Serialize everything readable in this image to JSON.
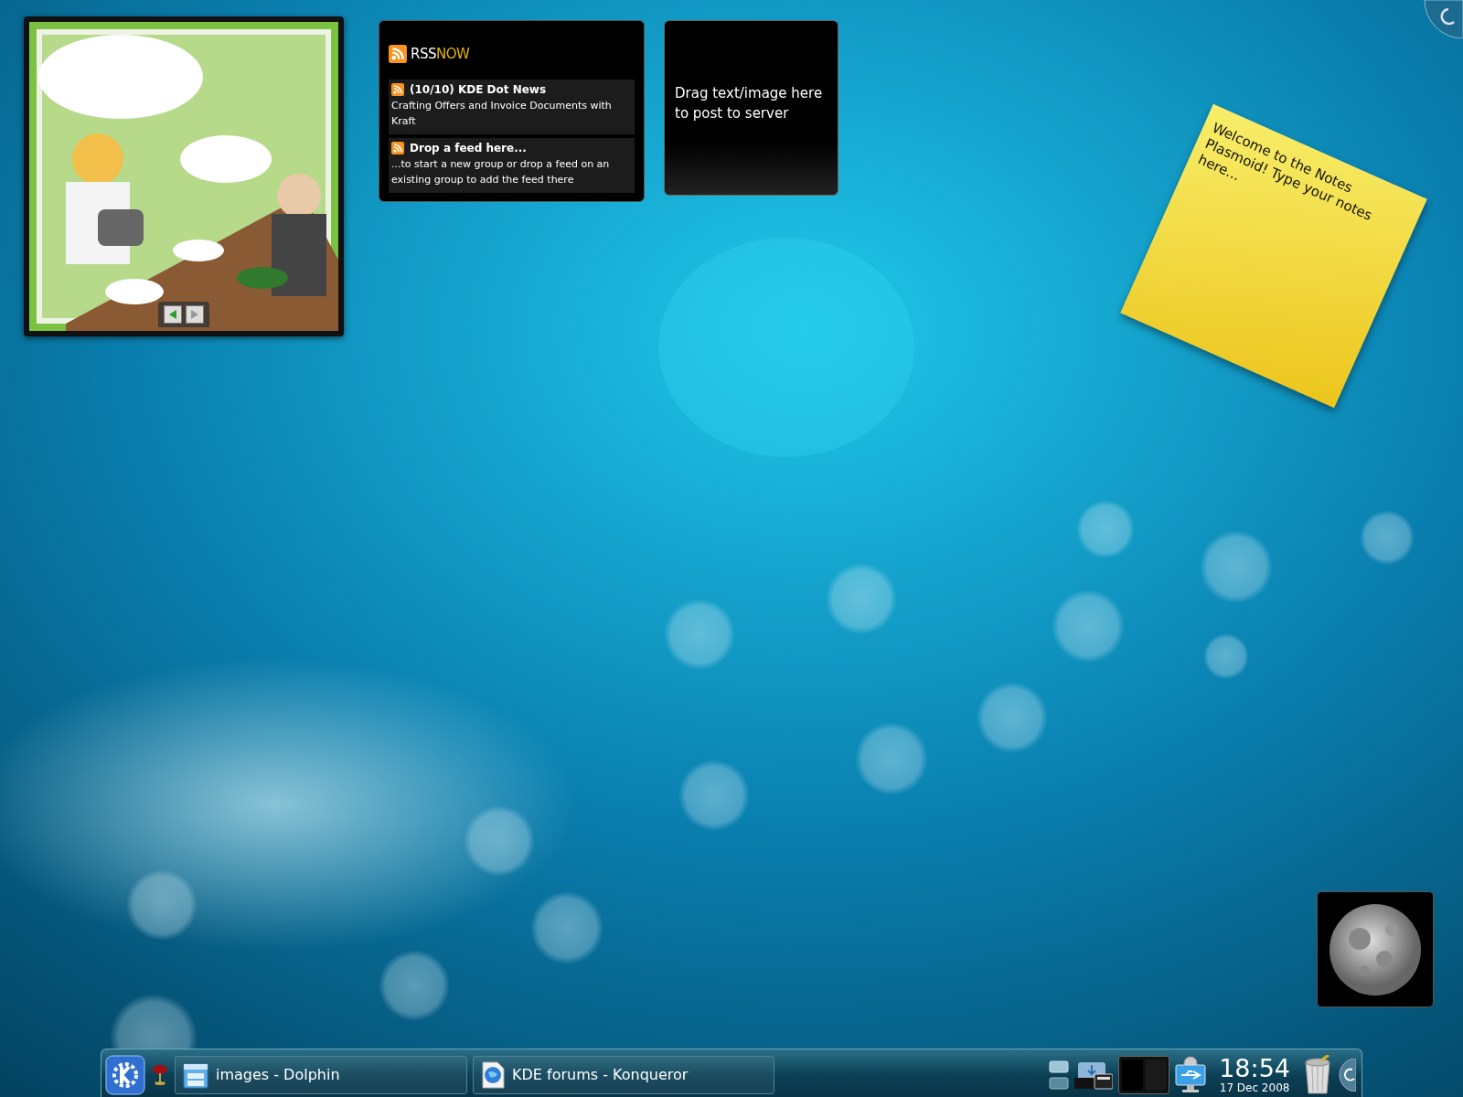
{
  "rss": {
    "logo": "RSS",
    "logo_accent": "NOW",
    "items": [
      {
        "title": "(10/10) KDE Dot News",
        "body": "Crafting Offers and Invoice Documents with Kraft"
      },
      {
        "title": "Drop a feed here...",
        "body": "...to start a new group or drop a feed on an existing group to add the feed there"
      }
    ]
  },
  "pastebin": {
    "text": "Drag text/image here to post to server"
  },
  "note": {
    "text": "Welcome to the Notes Plasmoid! Type your notes here..."
  },
  "taskbar": {
    "tasks": [
      {
        "label": "images - Dolphin",
        "kind": "folder"
      },
      {
        "label": "KDE forums - Konqueror",
        "kind": "browser"
      }
    ]
  },
  "clock": {
    "time": "18:54",
    "date": "17 Dec 2008"
  }
}
